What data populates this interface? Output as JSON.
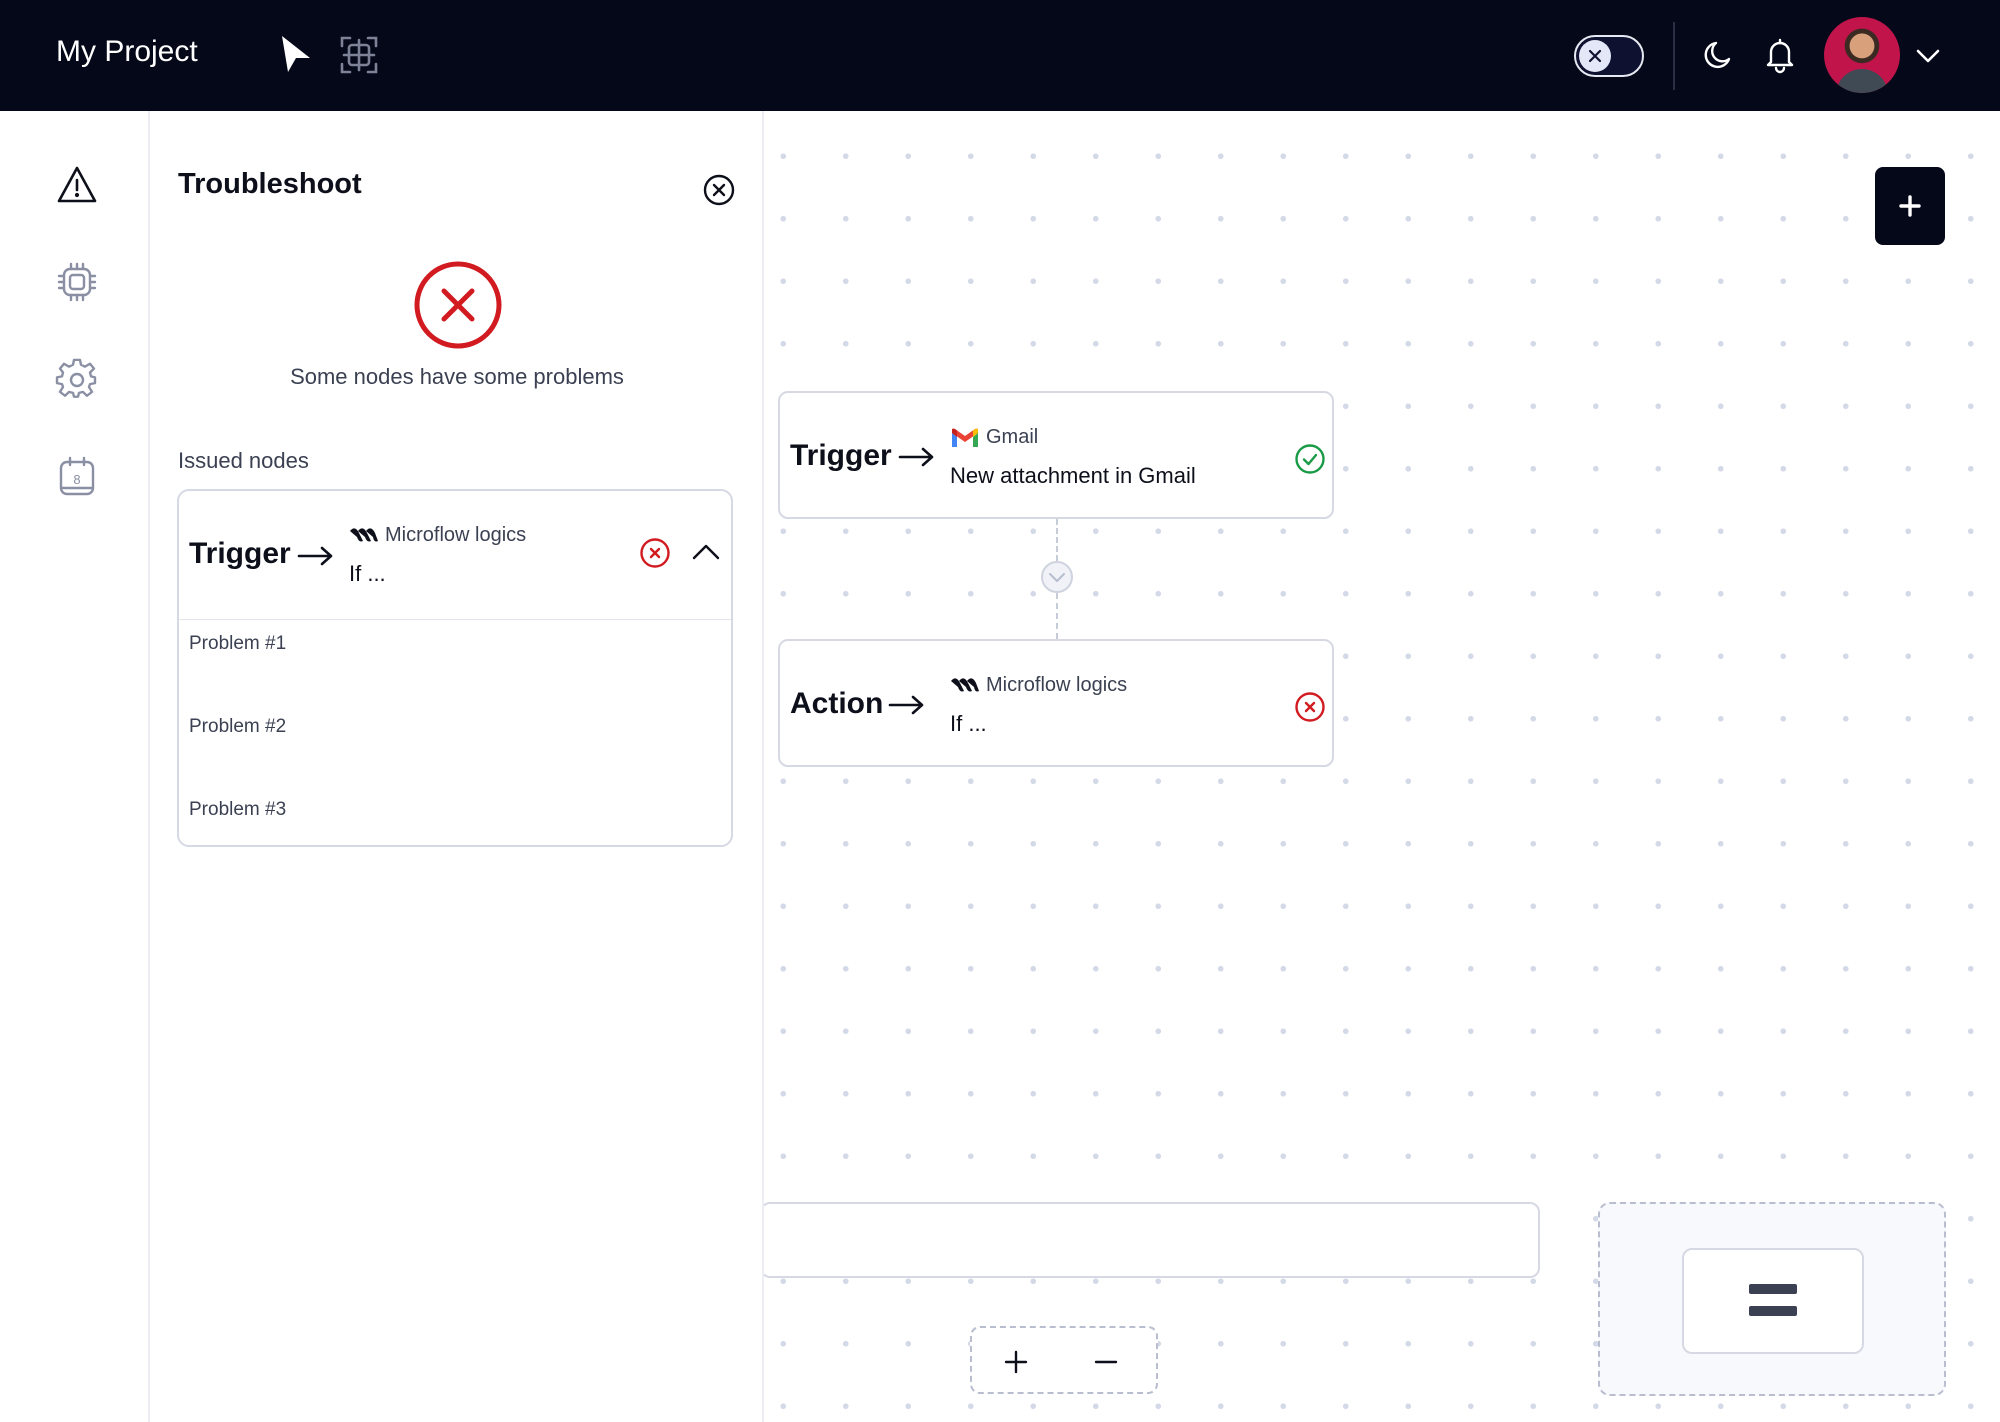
{
  "header": {
    "project_title": "My Project",
    "icons": [
      "cursor-icon",
      "frame-select-icon",
      "close-icon",
      "moon-icon",
      "bell-icon",
      "chevron-down-icon"
    ]
  },
  "sidebar": {
    "items": [
      {
        "icon": "warning-icon",
        "active": true
      },
      {
        "icon": "chip-icon"
      },
      {
        "icon": "gear-icon"
      },
      {
        "icon": "calendar-icon",
        "badge": "8"
      }
    ]
  },
  "troubleshoot": {
    "title": "Troubleshoot",
    "status_message": "Some nodes have some problems",
    "issued_label": "Issued nodes",
    "issued_nodes": [
      {
        "kind": "Trigger",
        "service": "Microflow logics",
        "description": "If ...",
        "problems": [
          "Problem #1",
          "Problem #2",
          "Problem #3"
        ]
      }
    ]
  },
  "canvas": {
    "nodes": [
      {
        "kind": "Trigger",
        "service": "Gmail",
        "description": "New attachment in Gmail",
        "status": "ok"
      },
      {
        "kind": "Action",
        "service": "Microflow logics",
        "description": "If ...",
        "status": "error"
      }
    ]
  },
  "colors": {
    "topbar": "#050818",
    "error": "#d11b20",
    "success": "#1a9a47",
    "border": "#d6d9e3",
    "text_muted": "#3b4152"
  }
}
